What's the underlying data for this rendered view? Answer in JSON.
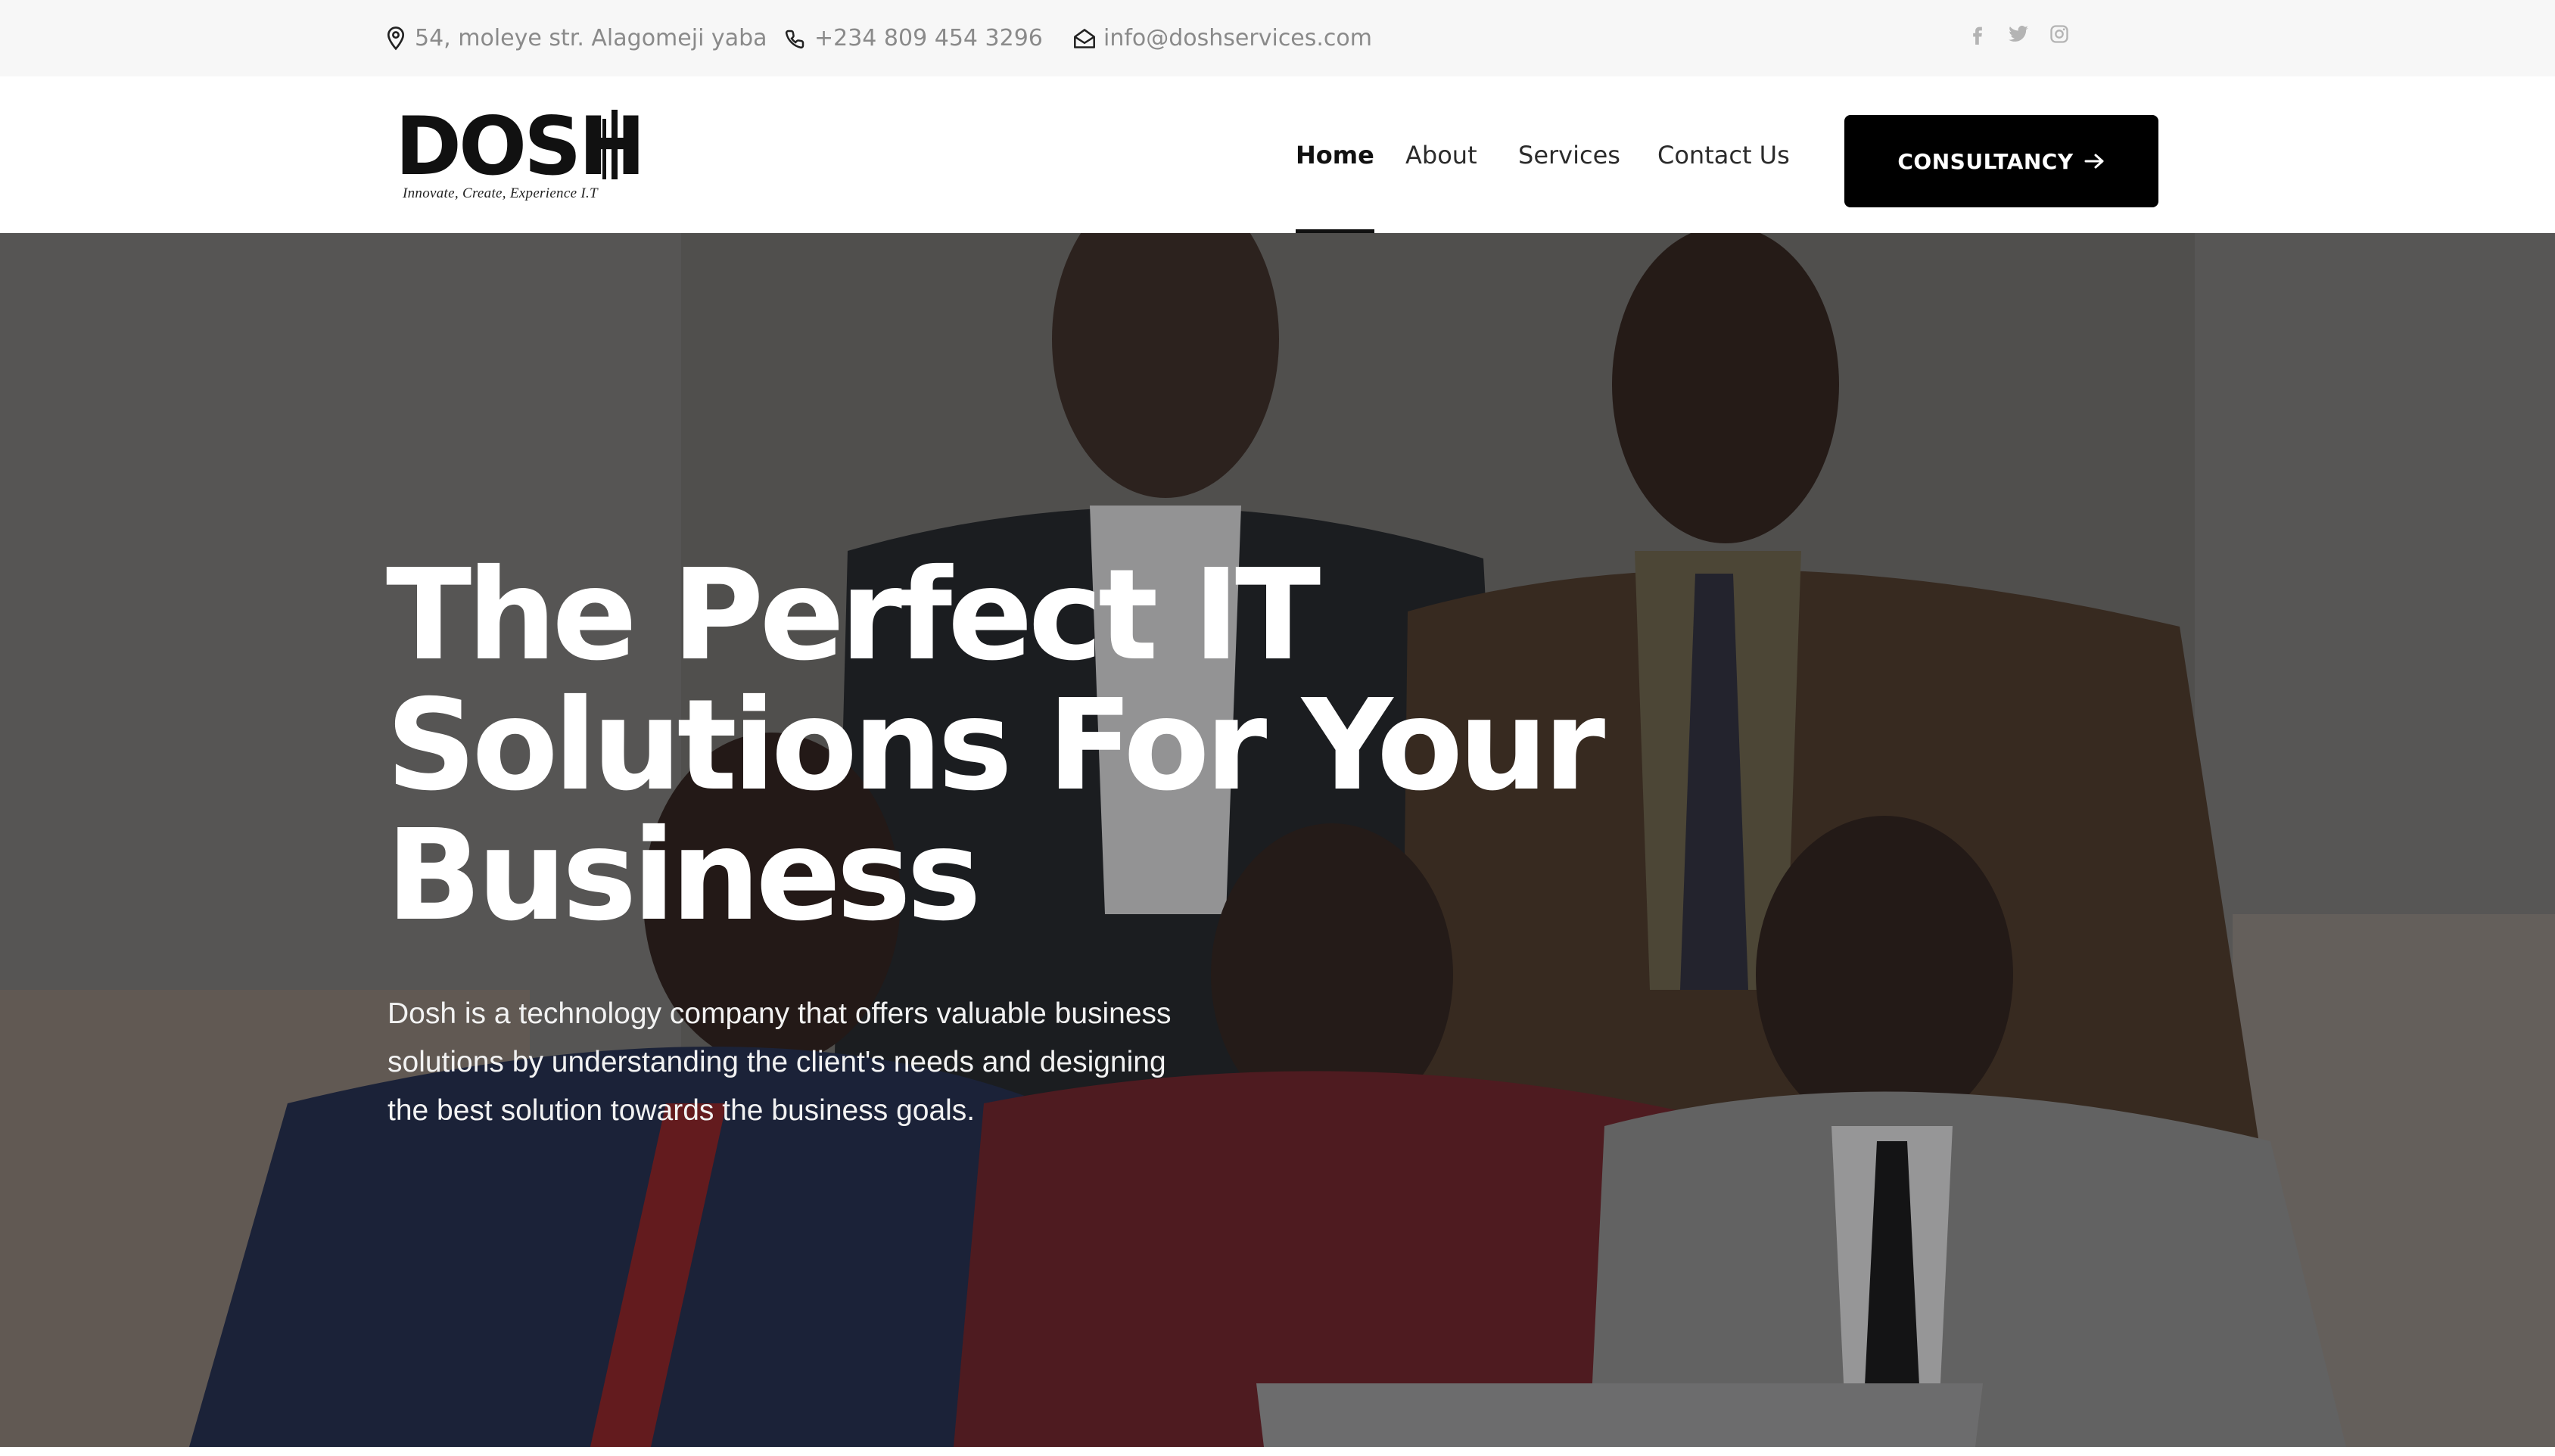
{
  "topbar": {
    "address": "54, moleye str. Alagomeji yaba",
    "phone": "+234 809 454 3296",
    "email": "info@doshservices.com",
    "address_icon": "location-pin-icon",
    "phone_icon": "phone-icon",
    "email_icon": "envelope-icon",
    "social": [
      "facebook-icon",
      "twitter-icon",
      "instagram-icon"
    ]
  },
  "header": {
    "logo_text": "DOSH",
    "logo_tagline": "Innovate, Create, Experience I.T",
    "nav": [
      {
        "label": "Home",
        "active": true
      },
      {
        "label": "About",
        "active": false
      },
      {
        "label": "Services",
        "active": false
      },
      {
        "label": "Contact Us",
        "active": false
      }
    ],
    "cta_label": "CONSULTANCY",
    "cta_icon": "arrow-right-icon"
  },
  "hero": {
    "title_lines": [
      "The Perfect IT",
      "Solutions For Your",
      "Business"
    ],
    "description_lines": [
      "Dosh is a technology company that offers valuable business",
      "solutions by understanding the client's needs and designing",
      "the best solution towards the business goals."
    ]
  },
  "colors": {
    "accent": "#000000",
    "topbar_bg": "#f7f7f7",
    "topbar_text": "#8a8a8a",
    "hero_text": "#ffffff"
  }
}
